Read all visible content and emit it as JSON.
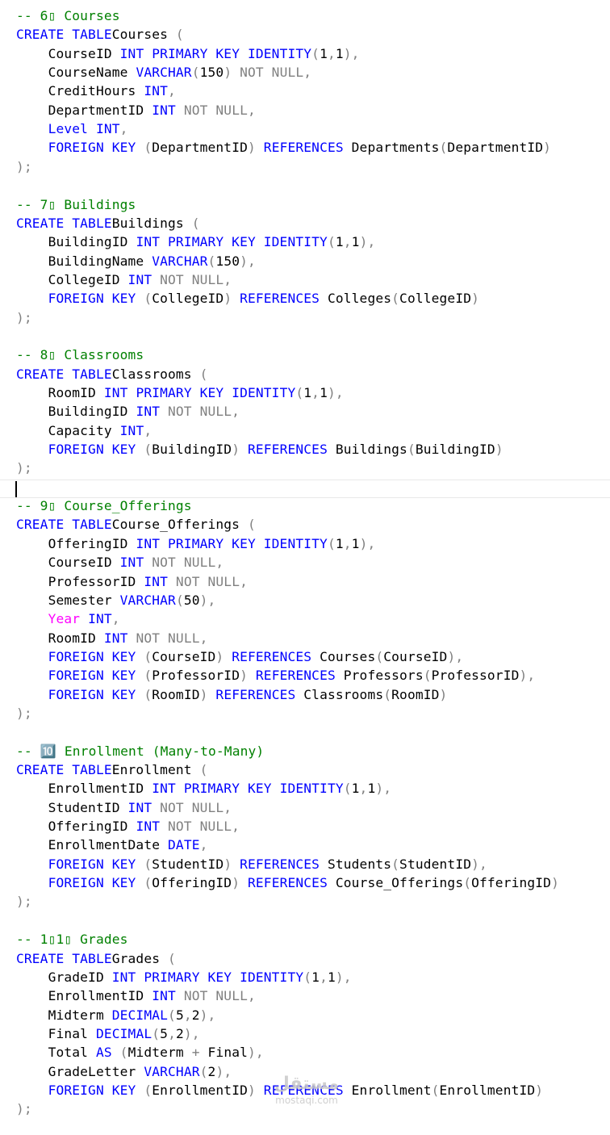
{
  "editor": {
    "current_line": 26,
    "lines": [
      [
        [
          "com",
          "-- 6▯ Courses"
        ]
      ],
      [
        [
          "kw",
          "CREATE TABLE"
        ],
        [
          "",
          "Courses "
        ],
        [
          "gray",
          "("
        ]
      ],
      [
        [
          "",
          "    CourseID "
        ],
        [
          "kw",
          "INT PRIMARY KEY IDENTITY"
        ],
        [
          "gray",
          "("
        ],
        [
          "",
          "1"
        ],
        [
          "gray",
          ","
        ],
        [
          "",
          "1"
        ],
        [
          "gray",
          "),"
        ]
      ],
      [
        [
          "",
          "    CourseName "
        ],
        [
          "kw",
          "VARCHAR"
        ],
        [
          "gray",
          "("
        ],
        [
          "",
          "150"
        ],
        [
          "gray",
          ") NOT NULL,"
        ]
      ],
      [
        [
          "",
          "    CreditHours "
        ],
        [
          "kw",
          "INT"
        ],
        [
          "gray",
          ","
        ]
      ],
      [
        [
          "",
          "    DepartmentID "
        ],
        [
          "kw",
          "INT"
        ],
        [
          "gray",
          " NOT NULL,"
        ]
      ],
      [
        [
          "kw",
          "    Level INT"
        ],
        [
          "gray",
          ","
        ]
      ],
      [
        [
          "kw",
          "    FOREIGN KEY "
        ],
        [
          "gray",
          "("
        ],
        [
          "",
          "DepartmentID"
        ],
        [
          "gray",
          ") "
        ],
        [
          "kw",
          "REFERENCES"
        ],
        [
          "",
          " Departments"
        ],
        [
          "gray",
          "("
        ],
        [
          "",
          "DepartmentID"
        ],
        [
          "gray",
          ")"
        ]
      ],
      [
        [
          "gray",
          ");"
        ]
      ],
      [],
      [
        [
          "com",
          "-- 7▯ Buildings"
        ]
      ],
      [
        [
          "kw",
          "CREATE TABLE"
        ],
        [
          "",
          "Buildings "
        ],
        [
          "gray",
          "("
        ]
      ],
      [
        [
          "",
          "    BuildingID "
        ],
        [
          "kw",
          "INT PRIMARY KEY IDENTITY"
        ],
        [
          "gray",
          "("
        ],
        [
          "",
          "1"
        ],
        [
          "gray",
          ","
        ],
        [
          "",
          "1"
        ],
        [
          "gray",
          "),"
        ]
      ],
      [
        [
          "",
          "    BuildingName "
        ],
        [
          "kw",
          "VARCHAR"
        ],
        [
          "gray",
          "("
        ],
        [
          "",
          "150"
        ],
        [
          "gray",
          "),"
        ]
      ],
      [
        [
          "",
          "    CollegeID "
        ],
        [
          "kw",
          "INT"
        ],
        [
          "gray",
          " NOT NULL,"
        ]
      ],
      [
        [
          "kw",
          "    FOREIGN KEY "
        ],
        [
          "gray",
          "("
        ],
        [
          "",
          "CollegeID"
        ],
        [
          "gray",
          ") "
        ],
        [
          "kw",
          "REFERENCES"
        ],
        [
          "",
          " Colleges"
        ],
        [
          "gray",
          "("
        ],
        [
          "",
          "CollegeID"
        ],
        [
          "gray",
          ")"
        ]
      ],
      [
        [
          "gray",
          ");"
        ]
      ],
      [],
      [
        [
          "com",
          "-- 8▯ Classrooms"
        ]
      ],
      [
        [
          "kw",
          "CREATE TABLE"
        ],
        [
          "",
          "Classrooms "
        ],
        [
          "gray",
          "("
        ]
      ],
      [
        [
          "",
          "    RoomID "
        ],
        [
          "kw",
          "INT PRIMARY KEY IDENTITY"
        ],
        [
          "gray",
          "("
        ],
        [
          "",
          "1"
        ],
        [
          "gray",
          ","
        ],
        [
          "",
          "1"
        ],
        [
          "gray",
          "),"
        ]
      ],
      [
        [
          "",
          "    BuildingID "
        ],
        [
          "kw",
          "INT"
        ],
        [
          "gray",
          " NOT NULL,"
        ]
      ],
      [
        [
          "",
          "    Capacity "
        ],
        [
          "kw",
          "INT"
        ],
        [
          "gray",
          ","
        ]
      ],
      [
        [
          "kw",
          "    FOREIGN KEY "
        ],
        [
          "gray",
          "("
        ],
        [
          "",
          "BuildingID"
        ],
        [
          "gray",
          ") "
        ],
        [
          "kw",
          "REFERENCES"
        ],
        [
          "",
          " Buildings"
        ],
        [
          "gray",
          "("
        ],
        [
          "",
          "BuildingID"
        ],
        [
          "gray",
          ")"
        ]
      ],
      [
        [
          "gray",
          ");"
        ]
      ],
      [],
      [
        [
          "com",
          "-- 9▯ Course_Offerings"
        ]
      ],
      [
        [
          "kw",
          "CREATE TABLE"
        ],
        [
          "",
          "Course_Offerings "
        ],
        [
          "gray",
          "("
        ]
      ],
      [
        [
          "",
          "    OfferingID "
        ],
        [
          "kw",
          "INT PRIMARY KEY IDENTITY"
        ],
        [
          "gray",
          "("
        ],
        [
          "",
          "1"
        ],
        [
          "gray",
          ","
        ],
        [
          "",
          "1"
        ],
        [
          "gray",
          "),"
        ]
      ],
      [
        [
          "",
          "    CourseID "
        ],
        [
          "kw",
          "INT"
        ],
        [
          "gray",
          " NOT NULL,"
        ]
      ],
      [
        [
          "",
          "    ProfessorID "
        ],
        [
          "kw",
          "INT"
        ],
        [
          "gray",
          " NOT NULL,"
        ]
      ],
      [
        [
          "",
          "    Semester "
        ],
        [
          "kw",
          "VARCHAR"
        ],
        [
          "gray",
          "("
        ],
        [
          "",
          "50"
        ],
        [
          "gray",
          "),"
        ]
      ],
      [
        [
          "mag",
          "    Year"
        ],
        [
          "kw",
          " INT"
        ],
        [
          "gray",
          ","
        ]
      ],
      [
        [
          "",
          "    RoomID "
        ],
        [
          "kw",
          "INT"
        ],
        [
          "gray",
          " NOT NULL,"
        ]
      ],
      [
        [
          "kw",
          "    FOREIGN KEY "
        ],
        [
          "gray",
          "("
        ],
        [
          "",
          "CourseID"
        ],
        [
          "gray",
          ") "
        ],
        [
          "kw",
          "REFERENCES"
        ],
        [
          "",
          " Courses"
        ],
        [
          "gray",
          "("
        ],
        [
          "",
          "CourseID"
        ],
        [
          "gray",
          "),"
        ]
      ],
      [
        [
          "kw",
          "    FOREIGN KEY "
        ],
        [
          "gray",
          "("
        ],
        [
          "",
          "ProfessorID"
        ],
        [
          "gray",
          ") "
        ],
        [
          "kw",
          "REFERENCES"
        ],
        [
          "",
          " Professors"
        ],
        [
          "gray",
          "("
        ],
        [
          "",
          "ProfessorID"
        ],
        [
          "gray",
          "),"
        ]
      ],
      [
        [
          "kw",
          "    FOREIGN KEY "
        ],
        [
          "gray",
          "("
        ],
        [
          "",
          "RoomID"
        ],
        [
          "gray",
          ") "
        ],
        [
          "kw",
          "REFERENCES"
        ],
        [
          "",
          " Classrooms"
        ],
        [
          "gray",
          "("
        ],
        [
          "",
          "RoomID"
        ],
        [
          "gray",
          ")"
        ]
      ],
      [
        [
          "gray",
          ");"
        ]
      ],
      [],
      [
        [
          "com",
          "-- 🔟 Enrollment (Many-to-Many)"
        ]
      ],
      [
        [
          "kw",
          "CREATE TABLE"
        ],
        [
          "",
          "Enrollment "
        ],
        [
          "gray",
          "("
        ]
      ],
      [
        [
          "",
          "    EnrollmentID "
        ],
        [
          "kw",
          "INT PRIMARY KEY IDENTITY"
        ],
        [
          "gray",
          "("
        ],
        [
          "",
          "1"
        ],
        [
          "gray",
          ","
        ],
        [
          "",
          "1"
        ],
        [
          "gray",
          "),"
        ]
      ],
      [
        [
          "",
          "    StudentID "
        ],
        [
          "kw",
          "INT"
        ],
        [
          "gray",
          " NOT NULL,"
        ]
      ],
      [
        [
          "",
          "    OfferingID "
        ],
        [
          "kw",
          "INT"
        ],
        [
          "gray",
          " NOT NULL,"
        ]
      ],
      [
        [
          "",
          "    EnrollmentDate "
        ],
        [
          "kw",
          "DATE"
        ],
        [
          "gray",
          ","
        ]
      ],
      [
        [
          "kw",
          "    FOREIGN KEY "
        ],
        [
          "gray",
          "("
        ],
        [
          "",
          "StudentID"
        ],
        [
          "gray",
          ") "
        ],
        [
          "kw",
          "REFERENCES"
        ],
        [
          "",
          " Students"
        ],
        [
          "gray",
          "("
        ],
        [
          "",
          "StudentID"
        ],
        [
          "gray",
          "),"
        ]
      ],
      [
        [
          "kw",
          "    FOREIGN KEY "
        ],
        [
          "gray",
          "("
        ],
        [
          "",
          "OfferingID"
        ],
        [
          "gray",
          ") "
        ],
        [
          "kw",
          "REFERENCES"
        ],
        [
          "",
          " Course_Offerings"
        ],
        [
          "gray",
          "("
        ],
        [
          "",
          "OfferingID"
        ],
        [
          "gray",
          ")"
        ]
      ],
      [
        [
          "gray",
          ");"
        ]
      ],
      [],
      [
        [
          "com",
          "-- 1▯1▯ Grades"
        ]
      ],
      [
        [
          "kw",
          "CREATE TABLE"
        ],
        [
          "",
          "Grades "
        ],
        [
          "gray",
          "("
        ]
      ],
      [
        [
          "",
          "    GradeID "
        ],
        [
          "kw",
          "INT PRIMARY KEY IDENTITY"
        ],
        [
          "gray",
          "("
        ],
        [
          "",
          "1"
        ],
        [
          "gray",
          ","
        ],
        [
          "",
          "1"
        ],
        [
          "gray",
          "),"
        ]
      ],
      [
        [
          "",
          "    EnrollmentID "
        ],
        [
          "kw",
          "INT"
        ],
        [
          "gray",
          " NOT NULL,"
        ]
      ],
      [
        [
          "",
          "    Midterm "
        ],
        [
          "kw",
          "DECIMAL"
        ],
        [
          "gray",
          "("
        ],
        [
          "",
          "5"
        ],
        [
          "gray",
          ","
        ],
        [
          "",
          "2"
        ],
        [
          "gray",
          "),"
        ]
      ],
      [
        [
          "",
          "    Final "
        ],
        [
          "kw",
          "DECIMAL"
        ],
        [
          "gray",
          "("
        ],
        [
          "",
          "5"
        ],
        [
          "gray",
          ","
        ],
        [
          "",
          "2"
        ],
        [
          "gray",
          "),"
        ]
      ],
      [
        [
          "",
          "    Total "
        ],
        [
          "kw",
          "AS"
        ],
        [
          "gray",
          " ("
        ],
        [
          "",
          "Midterm "
        ],
        [
          "gray",
          "+"
        ],
        [
          "",
          " Final"
        ],
        [
          "gray",
          "),"
        ]
      ],
      [
        [
          "",
          "    GradeLetter "
        ],
        [
          "kw",
          "VARCHAR"
        ],
        [
          "gray",
          "("
        ],
        [
          "",
          "2"
        ],
        [
          "gray",
          "),"
        ]
      ],
      [
        [
          "kw",
          "    FOREIGN KEY "
        ],
        [
          "gray",
          "("
        ],
        [
          "",
          "EnrollmentID"
        ],
        [
          "gray",
          ") "
        ],
        [
          "kw",
          "REFERENCES"
        ],
        [
          "",
          " Enrollment"
        ],
        [
          "gray",
          "("
        ],
        [
          "",
          "EnrollmentID"
        ],
        [
          "gray",
          ")"
        ]
      ],
      [
        [
          "gray",
          ");"
        ]
      ]
    ]
  },
  "watermark": {
    "logo": "مستقل",
    "text": "mostaqi.com"
  }
}
